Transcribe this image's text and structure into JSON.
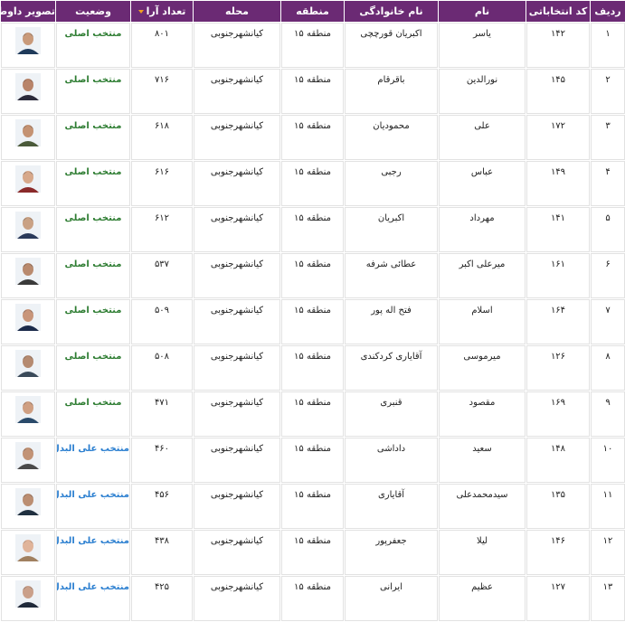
{
  "headers": {
    "rank": "ردیف",
    "code": "کد انتخاباتی",
    "first_name": "نام",
    "last_name": "نام خانوادگی",
    "region": "منطقه",
    "district": "محله",
    "votes": "تعداد آرا",
    "status": "وضعیت",
    "photo": "تصویر داوطلب"
  },
  "rows": [
    {
      "rank": "۱",
      "code": "۱۴۲",
      "first_name": "یاسر",
      "last_name": "اکبریان قورچچی",
      "region": "منطقه ۱۵",
      "district": "کیانشهرجنوبی",
      "votes": "۸۰۱",
      "status": "منتخب اصلی",
      "status_type": "main"
    },
    {
      "rank": "۲",
      "code": "۱۴۵",
      "first_name": "نورالدین",
      "last_name": "باقرقام",
      "region": "منطقه ۱۵",
      "district": "کیانشهرجنوبی",
      "votes": "۷۱۶",
      "status": "منتخب اصلی",
      "status_type": "main"
    },
    {
      "rank": "۳",
      "code": "۱۷۲",
      "first_name": "علی",
      "last_name": "محمودیان",
      "region": "منطقه ۱۵",
      "district": "کیانشهرجنوبی",
      "votes": "۶۱۸",
      "status": "منتخب اصلی",
      "status_type": "main"
    },
    {
      "rank": "۴",
      "code": "۱۴۹",
      "first_name": "عباس",
      "last_name": "رجبی",
      "region": "منطقه ۱۵",
      "district": "کیانشهرجنوبی",
      "votes": "۶۱۶",
      "status": "منتخب اصلی",
      "status_type": "main"
    },
    {
      "rank": "۵",
      "code": "۱۴۱",
      "first_name": "مهرداد",
      "last_name": "اکبریان",
      "region": "منطقه ۱۵",
      "district": "کیانشهرجنوبی",
      "votes": "۶۱۲",
      "status": "منتخب اصلی",
      "status_type": "main"
    },
    {
      "rank": "۶",
      "code": "۱۶۱",
      "first_name": "میرعلی اکبر",
      "last_name": "عطائی شرفه",
      "region": "منطقه ۱۵",
      "district": "کیانشهرجنوبی",
      "votes": "۵۳۷",
      "status": "منتخب اصلی",
      "status_type": "main"
    },
    {
      "rank": "۷",
      "code": "۱۶۴",
      "first_name": "اسلام",
      "last_name": "فتح اله پور",
      "region": "منطقه ۱۵",
      "district": "کیانشهرجنوبی",
      "votes": "۵۰۹",
      "status": "منتخب اصلی",
      "status_type": "main"
    },
    {
      "rank": "۸",
      "code": "۱۲۶",
      "first_name": "میرموسی",
      "last_name": "آقایاری کردکندی",
      "region": "منطقه ۱۵",
      "district": "کیانشهرجنوبی",
      "votes": "۵۰۸",
      "status": "منتخب اصلی",
      "status_type": "main"
    },
    {
      "rank": "۹",
      "code": "۱۶۹",
      "first_name": "مقصود",
      "last_name": "قنبری",
      "region": "منطقه ۱۵",
      "district": "کیانشهرجنوبی",
      "votes": "۴۷۱",
      "status": "منتخب اصلی",
      "status_type": "main"
    },
    {
      "rank": "۱۰",
      "code": "۱۴۸",
      "first_name": "سعید",
      "last_name": "داداشی",
      "region": "منطقه ۱۵",
      "district": "کیانشهرجنوبی",
      "votes": "۴۶۰",
      "status": "منتخب علی البدل",
      "status_type": "alt"
    },
    {
      "rank": "۱۱",
      "code": "۱۳۵",
      "first_name": "سیدمحمدعلی",
      "last_name": "آقایاری",
      "region": "منطقه ۱۵",
      "district": "کیانشهرجنوبی",
      "votes": "۴۵۶",
      "status": "منتخب علی البدل",
      "status_type": "alt"
    },
    {
      "rank": "۱۲",
      "code": "۱۴۶",
      "first_name": "لیلا",
      "last_name": "جعفرپور",
      "region": "منطقه ۱۵",
      "district": "کیانشهرجنوبی",
      "votes": "۴۳۸",
      "status": "منتخب علی البدل",
      "status_type": "alt"
    },
    {
      "rank": "۱۳",
      "code": "۱۲۷",
      "first_name": "عظیم",
      "last_name": "ایرانی",
      "region": "منطقه ۱۵",
      "district": "کیانشهرجنوبی",
      "votes": "۴۲۵",
      "status": "منتخب علی البدل",
      "status_type": "alt"
    }
  ],
  "colors": {
    "header_bg": "#6b2a74",
    "status_main": "#2e7d32",
    "status_alt": "#2b7fd0",
    "sort_arrow": "#f0a020"
  },
  "icons": {
    "sort": "sort-desc-icon",
    "photo": "candidate-photo-icon"
  }
}
